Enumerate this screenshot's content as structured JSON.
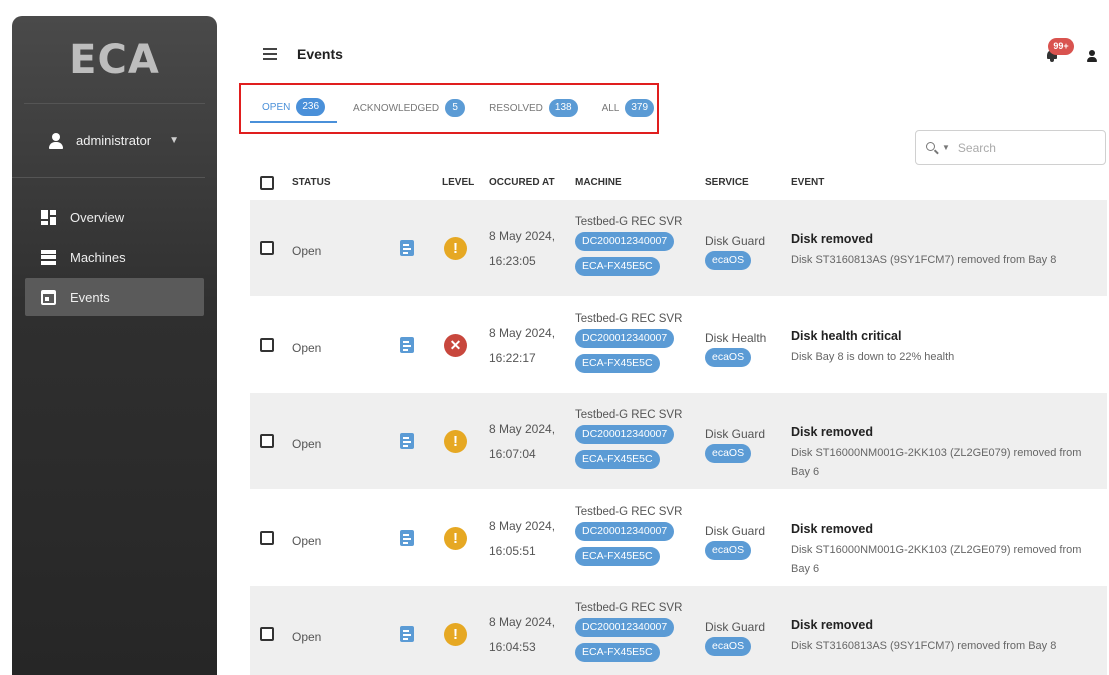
{
  "app": {
    "logo": "ECA"
  },
  "sidebar": {
    "user": "administrator",
    "items": [
      {
        "label": "Overview",
        "icon": "overview-icon"
      },
      {
        "label": "Machines",
        "icon": "machines-icon"
      },
      {
        "label": "Events",
        "icon": "events-icon",
        "active": true
      }
    ]
  },
  "header": {
    "title": "Events",
    "notifications_badge": "99+"
  },
  "tabs": [
    {
      "label": "OPEN",
      "count": "236",
      "active": true
    },
    {
      "label": "ACKNOWLEDGED",
      "count": "5"
    },
    {
      "label": "RESOLVED",
      "count": "138"
    },
    {
      "label": "ALL",
      "count": "379"
    }
  ],
  "search": {
    "placeholder": "Search"
  },
  "table": {
    "columns": {
      "status": "STATUS",
      "level": "LEVEL",
      "occurred": "OCCURED AT",
      "machine": "MACHINE",
      "service": "SERVICE",
      "event": "EVENT"
    },
    "rows": [
      {
        "status": "Open",
        "level": "warning",
        "level_glyph": "!",
        "date": "8 May 2024,",
        "time": "16:23:05",
        "machine": "Testbed-G REC SVR",
        "tag1": "DC200012340007",
        "tag2": "ECA-FX45E5C",
        "service": "Disk Guard",
        "service_tag": "ecaOS",
        "event_title": "Disk removed",
        "event_desc": "Disk ST3160813AS (9SY1FCM7) removed from Bay 8"
      },
      {
        "status": "Open",
        "level": "critical",
        "level_glyph": "✕",
        "date": "8 May 2024,",
        "time": "16:22:17",
        "machine": "Testbed-G REC SVR",
        "tag1": "DC200012340007",
        "tag2": "ECA-FX45E5C",
        "service": "Disk Health",
        "service_tag": "ecaOS",
        "event_title": "Disk health critical",
        "event_desc": "Disk Bay 8 is down to 22% health"
      },
      {
        "status": "Open",
        "level": "warning",
        "level_glyph": "!",
        "date": "8 May 2024,",
        "time": "16:07:04",
        "machine": "Testbed-G REC SVR",
        "tag1": "DC200012340007",
        "tag2": "ECA-FX45E5C",
        "service": "Disk Guard",
        "service_tag": "ecaOS",
        "event_title": "Disk removed",
        "event_desc": "Disk ST16000NM001G-2KK103 (ZL2GE079) removed from Bay 6"
      },
      {
        "status": "Open",
        "level": "warning",
        "level_glyph": "!",
        "date": "8 May 2024,",
        "time": "16:05:51",
        "machine": "Testbed-G REC SVR",
        "tag1": "DC200012340007",
        "tag2": "ECA-FX45E5C",
        "service": "Disk Guard",
        "service_tag": "ecaOS",
        "event_title": "Disk removed",
        "event_desc": "Disk ST16000NM001G-2KK103 (ZL2GE079) removed from Bay 6"
      },
      {
        "status": "Open",
        "level": "warning",
        "level_glyph": "!",
        "date": "8 May 2024,",
        "time": "16:04:53",
        "machine": "Testbed-G REC SVR",
        "tag1": "DC200012340007",
        "tag2": "ECA-FX45E5C",
        "service": "Disk Guard",
        "service_tag": "ecaOS",
        "event_title": "Disk removed",
        "event_desc": "Disk ST3160813AS (9SY1FCM7) removed from Bay 8"
      }
    ]
  }
}
